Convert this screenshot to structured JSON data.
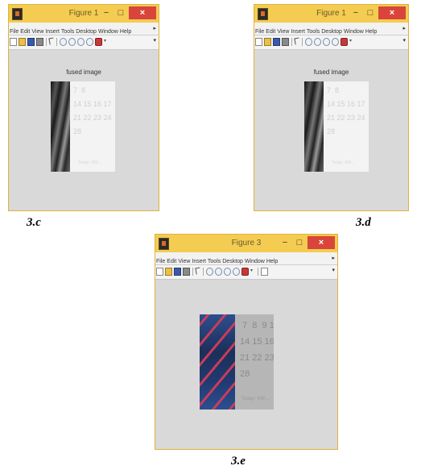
{
  "windows": [
    {
      "title": "Figure 1",
      "axes_title": "fused image",
      "calendar_text": "7  8\n14 15 16 17\n21 22 23 24\n28",
      "calendar_footer": "Today: 4/9/..."
    },
    {
      "title": "Figure 1",
      "axes_title": "fused image",
      "calendar_text": "7  8\n14 15 16 17\n21 22 23 24\n28",
      "calendar_footer": "Today: 4/9/..."
    },
    {
      "title": "Figure 3",
      "axes_title": "",
      "calendar_text": " 7  8  9 10\n14 15 16 17\n21 22 23 24\n28",
      "calendar_footer": "Today: 4/9/..."
    }
  ],
  "menu_items": [
    "File",
    "Edit",
    "View",
    "Insert",
    "Tools",
    "Desktop",
    "Window",
    "Help"
  ],
  "title_buttons": {
    "minimize": "−",
    "maximize": "□",
    "close": "×"
  },
  "captions": {
    "c": "3.c",
    "d": "3.d",
    "e": "3.e"
  },
  "colors": {
    "titlebar": "#f4cc52",
    "close_button": "#d9453a",
    "figure_background": "#d9d9d9"
  }
}
